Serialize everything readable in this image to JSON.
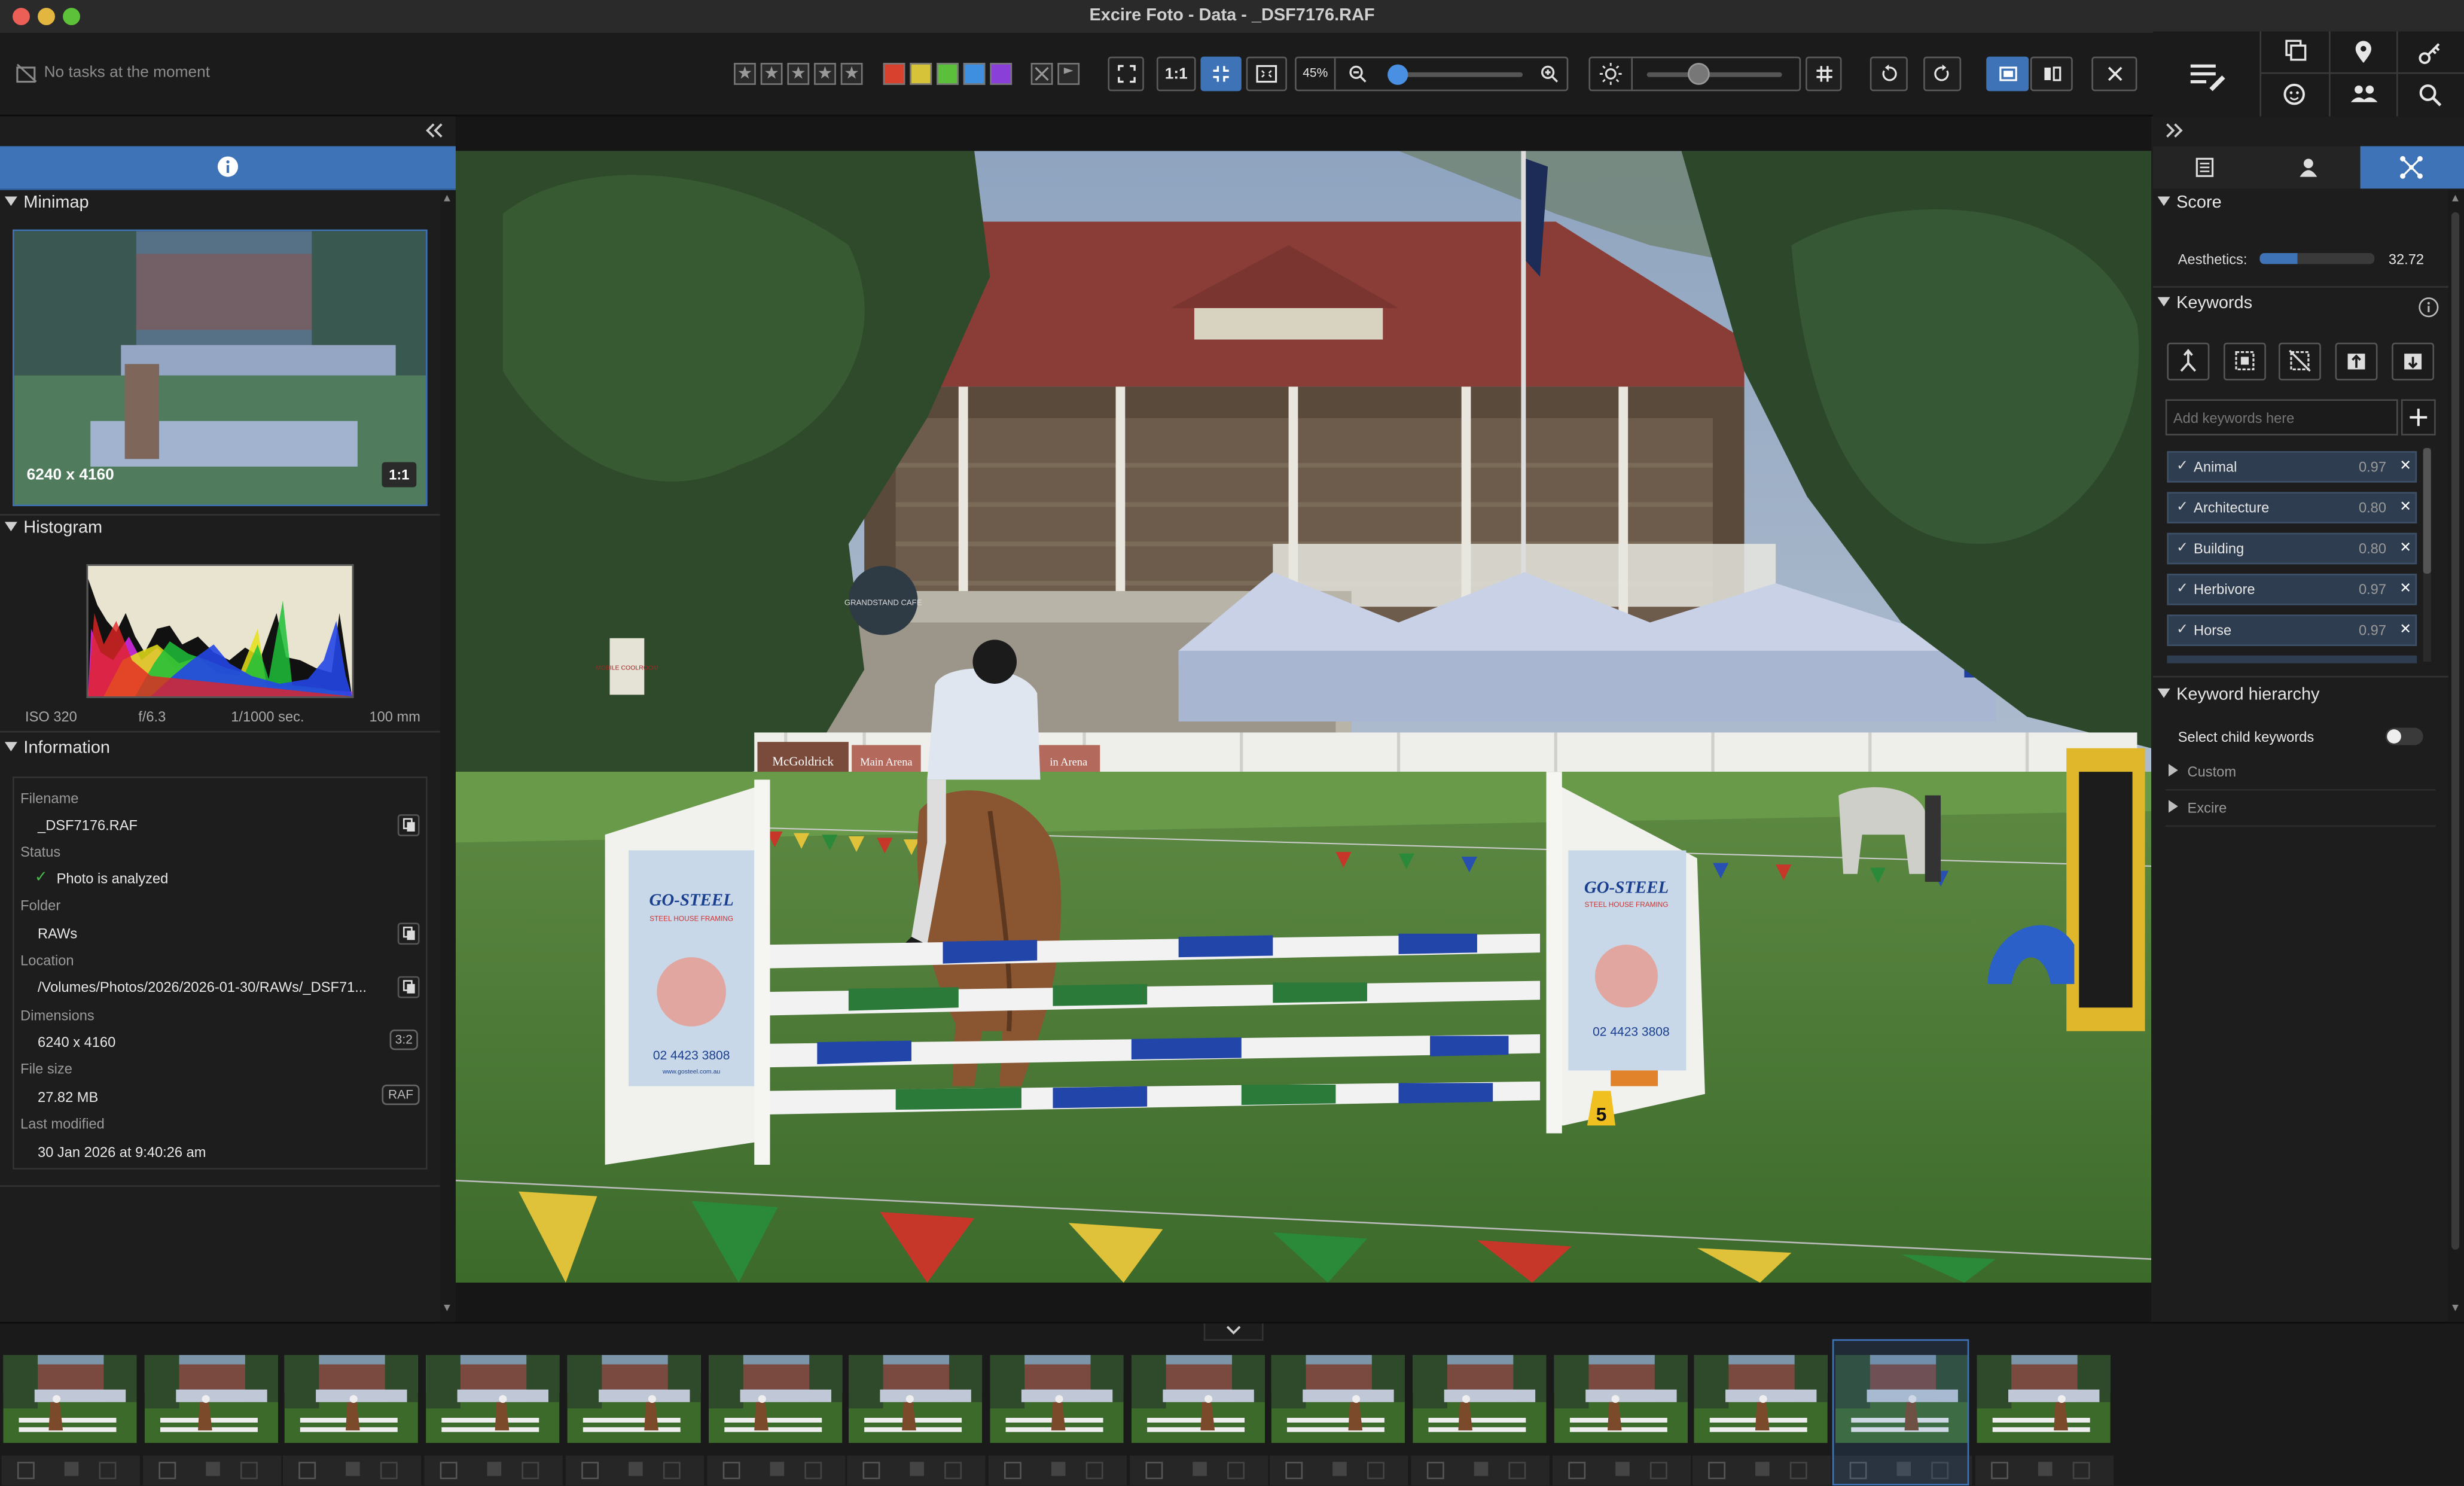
{
  "window": {
    "title": "Excire Foto - Data - _DSF7176.RAF"
  },
  "toolbar": {
    "tasks_text": "No tasks at the moment",
    "one_to_one": "1:1",
    "zoom_percent": "45%",
    "zoom_level": 0.03,
    "brightness_level": 0.38
  },
  "left": {
    "minimap_title": "Minimap",
    "minimap_dims": "6240 x 4160",
    "minimap_ratio": "1:1",
    "histogram_title": "Histogram",
    "exif": {
      "iso": "ISO 320",
      "aperture": "f/6.3",
      "shutter": "1/1000 sec.",
      "focal": "100 mm"
    },
    "info_title": "Information",
    "info": {
      "filename_label": "Filename",
      "filename": "_DSF7176.RAF",
      "status_label": "Status",
      "status": "Photo is analyzed",
      "folder_label": "Folder",
      "folder": "RAWs",
      "location_label": "Location",
      "location": "/Volumes/Photos/2026/2026-01-30/RAWs/_DSF71...",
      "dimensions_label": "Dimensions",
      "dimensions": "6240 x 4160",
      "aspect": "3:2",
      "filesize_label": "File size",
      "filesize": "27.82 MB",
      "format": "RAF",
      "modified_label": "Last modified",
      "modified": "30 Jan 2026 at 9:40:26 am"
    }
  },
  "photo": {
    "sign_1": "McGoldrick",
    "sign_2": "Main Arena",
    "sign_3": "in Arena",
    "jump_brand": "GO-STEEL",
    "jump_sub": "STEEL HOUSE FRAMING",
    "jump_phone": "02 4423 3808",
    "jump_url": "www.gosteel.com.au",
    "arena_number": "5",
    "grandstand_sign": "GRANDSTAND CAFE",
    "mobile_sign": "MOBILE COOLROOM"
  },
  "right": {
    "score_title": "Score",
    "aesthetics_label": "Aesthetics:",
    "aesthetics_value": "32.72",
    "aesthetics_level": 0.33,
    "keywords_title": "Keywords",
    "keyword_placeholder": "Add keywords here",
    "keywords": [
      {
        "name": "Animal",
        "score": "0.97"
      },
      {
        "name": "Architecture",
        "score": "0.80"
      },
      {
        "name": "Building",
        "score": "0.80"
      },
      {
        "name": "Herbivore",
        "score": "0.97"
      },
      {
        "name": "Horse",
        "score": "0.97"
      }
    ],
    "hierarchy_title": "Keyword hierarchy",
    "select_child_label": "Select child keywords",
    "tree": [
      "Custom",
      "Excire"
    ]
  },
  "colors": {
    "accent": "#3e74b7",
    "label_red": "#d9412f",
    "label_yellow": "#d6c33a",
    "label_green": "#5cbf3b",
    "label_blue": "#3f8fe0",
    "label_purple": "#8a3fd8"
  }
}
